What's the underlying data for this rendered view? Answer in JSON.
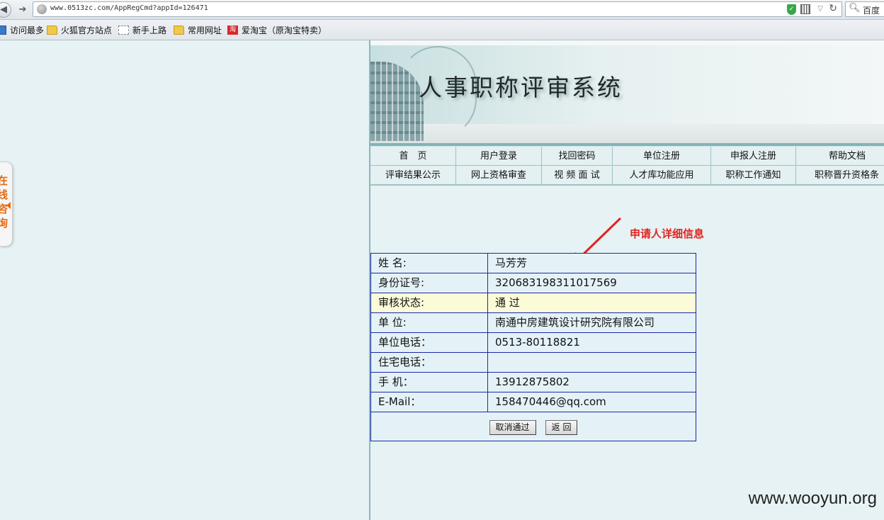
{
  "browser": {
    "url": "www.0513zc.com/AppRegCmd?appId=126471",
    "search_text": "百度",
    "bookmarks": [
      {
        "label": "访问最多",
        "icon": "blue-page-icon"
      },
      {
        "label": "火狐官方站点",
        "icon": "folder-icon"
      },
      {
        "label": "新手上路",
        "icon": "page-icon"
      },
      {
        "label": "常用网址",
        "icon": "folder-icon"
      },
      {
        "label": "爱淘宝（原淘宝特卖）",
        "icon": "taobao-icon"
      }
    ]
  },
  "side_tab": {
    "text": "在线咨询"
  },
  "banner": {
    "title": "人事职称评审系统"
  },
  "menu": {
    "row1": [
      "首　页",
      "用户登录",
      "找回密码",
      "单位注册",
      "申报人注册",
      "帮助文档"
    ],
    "row2": [
      "评审结果公示",
      "网上资格审查",
      "视 频 面 试",
      "人才库功能应用",
      "职称工作通知",
      "职称晋升资格条"
    ]
  },
  "annotation": {
    "label": "申请人详细信息",
    "color": "#e32222"
  },
  "info": {
    "rows": [
      {
        "label": "姓 名:",
        "value": "马芳芳"
      },
      {
        "label": "身份证号:",
        "value": "320683198311017569"
      },
      {
        "label": "审核状态:",
        "value": "通 过"
      },
      {
        "label": "单 位:",
        "value": "南通中房建筑设计研究院有限公司"
      },
      {
        "label": "单位电话：",
        "value": "0513-80118821"
      },
      {
        "label": "住宅电话：",
        "value": ""
      },
      {
        "label": "手 机：",
        "value": "13912875802"
      },
      {
        "label": "E-Mail：",
        "value": "158470446@qq.com"
      }
    ],
    "cancel_button": "取消通过",
    "back_button": "返 回"
  },
  "watermark": "www.wooyun.org"
}
